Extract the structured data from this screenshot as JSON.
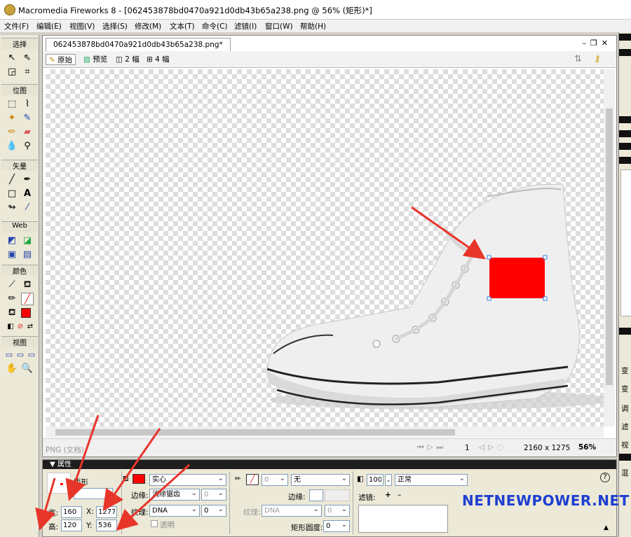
{
  "window": {
    "title": "Macromedia Fireworks 8 - [062453878bd0470a921d0db43b65a238.png @  56% (矩形)*]"
  },
  "menu": [
    "文件(F)",
    "编辑(E)",
    "视图(V)",
    "选择(S)",
    "修改(M)",
    "文本(T)",
    "命令(C)",
    "滤镜(I)",
    "窗口(W)",
    "帮助(H)"
  ],
  "toolbox": {
    "sections": [
      "选择",
      "位图",
      "矢量",
      "Web",
      "颜色",
      "视图"
    ],
    "fill_color": "#ff0000"
  },
  "document": {
    "tab": "062453878bd0470a921d0db43b65a238.png*",
    "view_tabs": [
      "原始",
      "预览",
      "2 幅",
      "4 幅"
    ],
    "status": {
      "type": "PNG (文档)",
      "frame": "1",
      "size": "2160 x 1275",
      "zoom": "56%"
    }
  },
  "properties": {
    "title": "属性",
    "shape_name": "矩形",
    "width_label": "宽:",
    "width": "160",
    "height_label": "高:",
    "height": "120",
    "x_label": "X:",
    "x": "1277",
    "y_label": "Y:",
    "y": "536",
    "fill_type": "实心",
    "fill_color": "#ff0000",
    "edge_label": "边缘:",
    "edge": "消除锯齿",
    "edge_amount": "0",
    "texture_label": "纹理:",
    "texture": "DNA",
    "texture_amount": "0",
    "transparent": "透明",
    "stroke_none": "无",
    "stroke_size": "0",
    "stroke_edge_label": "边缘:",
    "stroke_texture_label": "纹理:",
    "stroke_texture": "DNA",
    "stroke_texture_amount": "0",
    "roundness_label": "矩形圆度:",
    "roundness": "0",
    "opacity": "100",
    "blend": "正常",
    "filters_label": "滤镜:",
    "help": "?"
  },
  "right_panel": [
    "变",
    "变",
    "调",
    "滤",
    "视",
    "混"
  ],
  "watermark": "NETNEWPOWER.NET",
  "colors": {
    "accent": "#ff0000",
    "arrow": "#e8352a",
    "watermark": "#1e3fd1"
  }
}
